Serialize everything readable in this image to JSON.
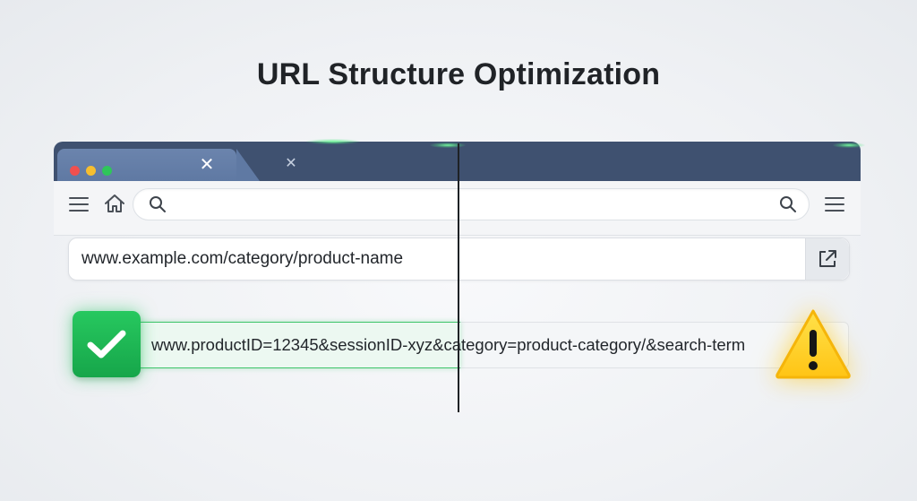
{
  "page": {
    "title": "URL Structure Optimization"
  },
  "browser": {
    "window_controls": [
      {
        "name": "close",
        "color": "#f0504f"
      },
      {
        "name": "minimize",
        "color": "#f6be2f"
      },
      {
        "name": "maximize",
        "color": "#2fc65a"
      }
    ],
    "tab_close_glyph": "✕",
    "second_tab_close_glyph": "✕",
    "toolbar_icons": [
      "hamburger-menu-icon",
      "home-icon",
      "search-icon",
      "search-icon",
      "hamburger-menu-icon"
    ],
    "search_placeholder": ""
  },
  "urls": {
    "good": "www.example.com/category/product-name",
    "bad": "www.productID=12345&sessionID-xyz&category=product-category/&search-term"
  },
  "badges": {
    "good": {
      "icon": "checkmark-icon",
      "color": "#1eb853"
    },
    "bad": {
      "icon": "warning-icon",
      "color": "#ffd21f"
    }
  }
}
